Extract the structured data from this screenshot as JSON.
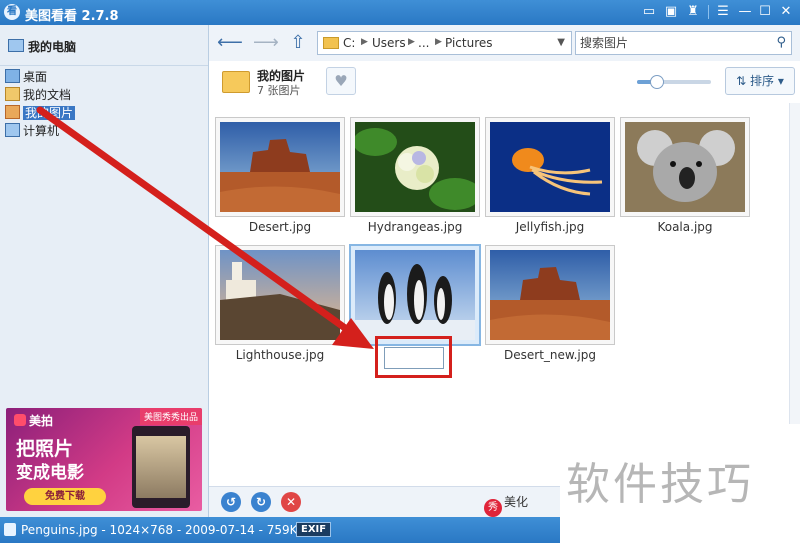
{
  "app": {
    "title": "美图看看 2.7.8",
    "icon_text": "看"
  },
  "window_controls": [
    "message-icon",
    "skin-icon",
    "shirt-icon",
    "menu-icon",
    "minimize-icon",
    "maximize-icon",
    "close-icon"
  ],
  "sidebar": {
    "root": "我的电脑",
    "items": [
      {
        "label": "桌面",
        "icon": "desktop-icon"
      },
      {
        "label": "我的文档",
        "icon": "documents-icon"
      },
      {
        "label": "我的图片",
        "icon": "pictures-icon",
        "selected": true
      },
      {
        "label": "计算机",
        "icon": "computer-icon"
      }
    ],
    "ad": {
      "brand": "美拍",
      "badge": "美图秀秀出品",
      "line1": "把照片",
      "line2": "变成电影",
      "button": "免费下载"
    }
  },
  "toolbar": {
    "path": [
      "C:",
      "Users",
      "...",
      "Pictures"
    ],
    "search_placeholder": "搜索图片"
  },
  "folder": {
    "name": "我的图片",
    "count": "7 张图片",
    "zoom_fraction": 0.25,
    "sort_label": "排序"
  },
  "images": [
    {
      "name": "Desert.jpg"
    },
    {
      "name": "Hydrangeas.jpg"
    },
    {
      "name": "Jellyfish.jpg"
    },
    {
      "name": "Koala.jpg"
    },
    {
      "name": "Lighthouse.jpg"
    },
    {
      "name": "",
      "selected": true,
      "renaming": true
    },
    {
      "name": "Desert_new.jpg"
    }
  ],
  "bottombar": {
    "beautify": "美化",
    "beautify_icon": "秀"
  },
  "status": {
    "text": "Penguins.jpg - 1024×768 - 2009-07-14 - 759KB",
    "exif": "EXIF"
  },
  "watermark": "软件技巧",
  "colors": {
    "titlebar": "#2a78c4",
    "selection": "#3a77c4",
    "annotation": "#d4201c"
  }
}
